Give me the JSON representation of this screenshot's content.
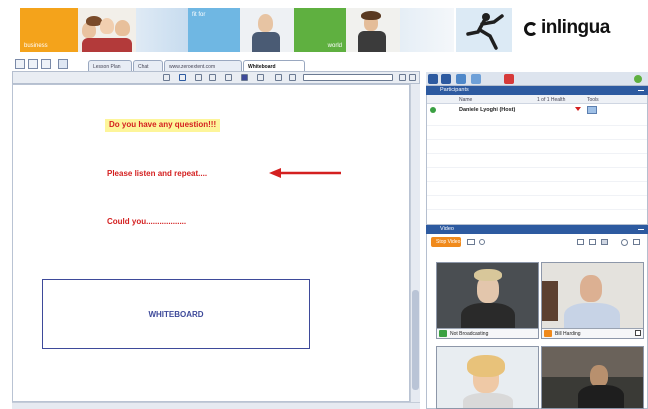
{
  "banner": {
    "tiles": [
      {
        "text": "business",
        "color": "#f4a31b"
      },
      {
        "text": "fit for",
        "color": "#6fb7e3"
      },
      {
        "text": "world",
        "color": "#5fb040"
      }
    ],
    "logo_text": "inlingua"
  },
  "tabs": [
    "Lesson Plan",
    "Chat",
    "www.zeroextent.com",
    "Whiteboard"
  ],
  "active_tab": "Whiteboard",
  "whiteboard": {
    "question": "Do you have any question!!!",
    "listen": "Please listen and repeat....",
    "could": "Could you..................",
    "box_label": "WHITEBOARD"
  },
  "participants": {
    "title": "Participants",
    "columns": {
      "name": "Name",
      "status": "1 of 1 Health",
      "tools": "Tools"
    },
    "rows": [
      {
        "name": "Daniele Lyoghi (Host)"
      }
    ]
  },
  "video": {
    "title": "Video",
    "stop_label": "Stop Video",
    "cells": [
      {
        "label": "Not Broadcasting",
        "status_color": "#3aa042"
      },
      {
        "label": "Bill Harding",
        "status_color": "#f08a1c"
      },
      {
        "label": "",
        "status_color": "#3aa042"
      },
      {
        "label": "",
        "status_color": "#3aa042"
      }
    ]
  },
  "colors": {
    "accent_blue": "#2d5aa0",
    "highlight_yellow": "#fdf59a",
    "text_red": "#d42020",
    "box_blue": "#3e4a9a",
    "orange": "#f08a1c"
  }
}
